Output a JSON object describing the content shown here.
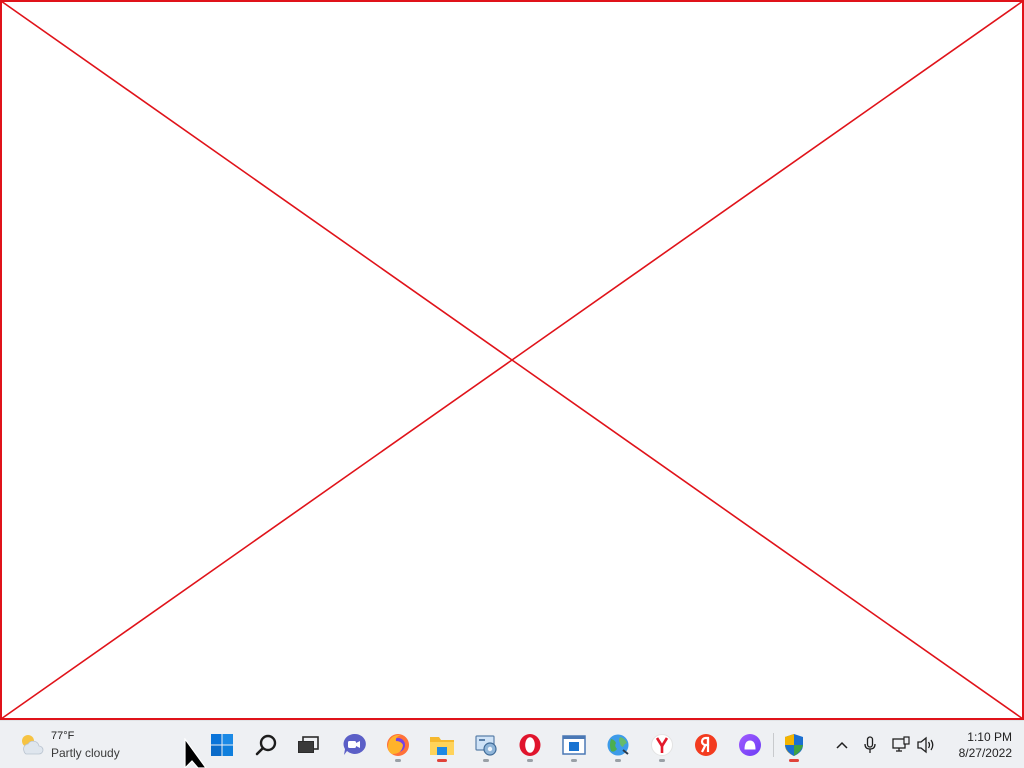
{
  "placeholder": {
    "color": "#e0131a"
  },
  "weather": {
    "icon": "partly-cloudy-icon",
    "temperature": "77°F",
    "condition": "Partly cloudy"
  },
  "taskbar": {
    "apps": [
      {
        "name": "Start",
        "icon": "windows-logo-icon",
        "running": false
      },
      {
        "name": "Search",
        "icon": "search-icon",
        "running": false
      },
      {
        "name": "Task View",
        "icon": "task-view-icon",
        "running": false
      },
      {
        "name": "Chat",
        "icon": "chat-icon",
        "running": false
      },
      {
        "name": "Firefox",
        "icon": "firefox-icon",
        "running": true
      },
      {
        "name": "File Explorer",
        "icon": "folder-icon",
        "running": true,
        "active": true
      },
      {
        "name": "Control Panel",
        "icon": "control-panel-icon",
        "running": true
      },
      {
        "name": "Opera",
        "icon": "opera-icon",
        "running": true
      },
      {
        "name": "App Window",
        "icon": "app-window-icon",
        "running": true
      },
      {
        "name": "Network Globe",
        "icon": "globe-icon",
        "running": true
      },
      {
        "name": "Yandex Browser",
        "icon": "yandex-browser-icon",
        "running": true
      },
      {
        "name": "Yandex",
        "icon": "yandex-icon",
        "running": false
      },
      {
        "name": "Alice",
        "icon": "alice-icon",
        "running": false
      },
      {
        "name": "Windows Security",
        "icon": "security-shield-icon",
        "running": true,
        "active": true
      }
    ]
  },
  "tray": {
    "chevron_icon": "chevron-up-icon",
    "mic_icon": "microphone-icon",
    "network_icon": "network-icon",
    "volume_icon": "volume-icon",
    "time": "1:10 PM",
    "date": "8/27/2022"
  },
  "cursor": {
    "icon": "mouse-pointer-icon"
  }
}
